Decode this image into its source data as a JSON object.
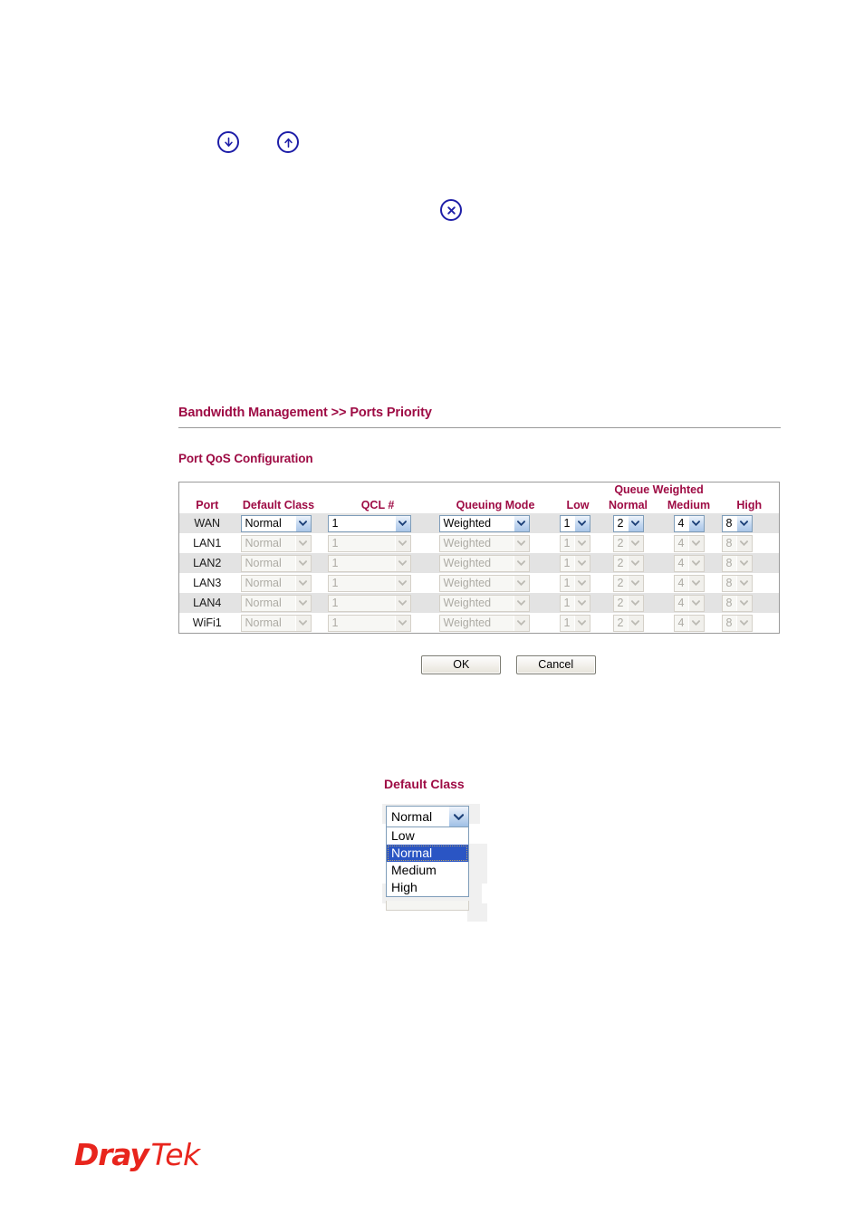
{
  "top_icons": [
    {
      "name": "download-circle-icon",
      "glyph": "arrow-down",
      "color": "#1f1fa8"
    },
    {
      "name": "upload-circle-icon",
      "glyph": "arrow-up",
      "color": "#1f1fa8"
    },
    {
      "name": "delete-circle-icon",
      "glyph": "cross",
      "color": "#1f1fa8"
    }
  ],
  "page": {
    "breadcrumb": "Bandwidth Management >> Ports Priority",
    "section_title": "Port QoS Configuration",
    "accent_color": "#9e0b44"
  },
  "table": {
    "headers": {
      "port": "Port",
      "default_class": "Default Class",
      "qcl": "QCL #",
      "queuing_mode": "Queuing Mode",
      "queue_weighted_group": "Queue Weighted",
      "low": "Low",
      "normal": "Normal",
      "medium": "Medium",
      "high": "High"
    },
    "rows": [
      {
        "port": "WAN",
        "default_class": "Normal",
        "qcl": "1",
        "queuing_mode": "Weighted",
        "low": "1",
        "normal": "2",
        "medium": "4",
        "high": "8",
        "enabled": true
      },
      {
        "port": "LAN1",
        "default_class": "Normal",
        "qcl": "1",
        "queuing_mode": "Weighted",
        "low": "1",
        "normal": "2",
        "medium": "4",
        "high": "8",
        "enabled": false
      },
      {
        "port": "LAN2",
        "default_class": "Normal",
        "qcl": "1",
        "queuing_mode": "Weighted",
        "low": "1",
        "normal": "2",
        "medium": "4",
        "high": "8",
        "enabled": false
      },
      {
        "port": "LAN3",
        "default_class": "Normal",
        "qcl": "1",
        "queuing_mode": "Weighted",
        "low": "1",
        "normal": "2",
        "medium": "4",
        "high": "8",
        "enabled": false
      },
      {
        "port": "LAN4",
        "default_class": "Normal",
        "qcl": "1",
        "queuing_mode": "Weighted",
        "low": "1",
        "normal": "2",
        "medium": "4",
        "high": "8",
        "enabled": false
      },
      {
        "port": "WiFi1",
        "default_class": "Normal",
        "qcl": "1",
        "queuing_mode": "Weighted",
        "low": "1",
        "normal": "2",
        "medium": "4",
        "high": "8",
        "enabled": false
      }
    ]
  },
  "buttons": {
    "ok": "OK",
    "cancel": "Cancel"
  },
  "dropdown_demo": {
    "label": "Default Class",
    "selected": "Normal",
    "options": [
      "Low",
      "Normal",
      "Medium",
      "High"
    ]
  },
  "footer": {
    "logo_part1": "Dray",
    "logo_part2": "Tek",
    "logo_color": "#e8251d"
  }
}
